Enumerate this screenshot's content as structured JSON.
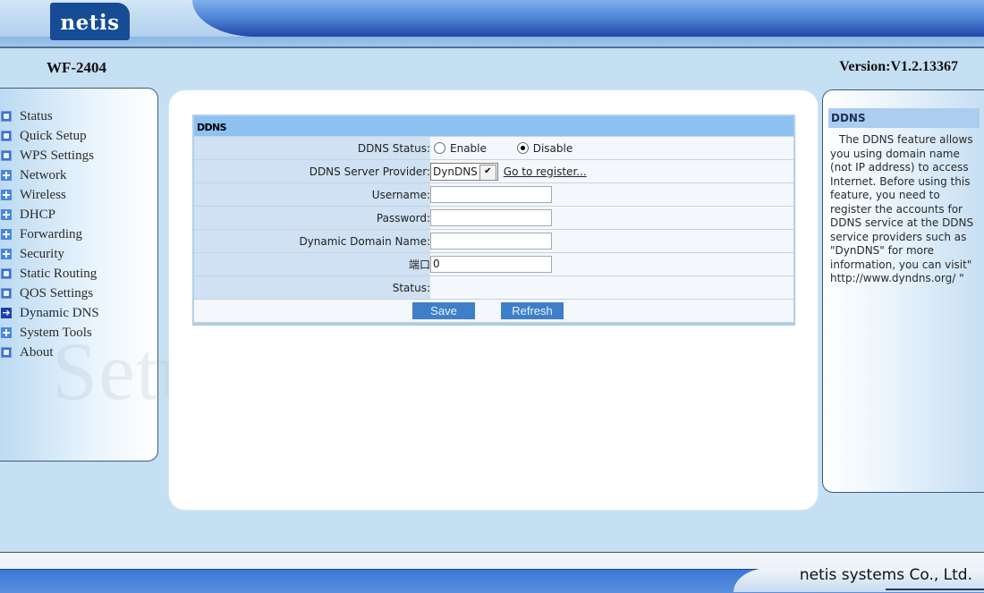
{
  "header": {
    "logo": "netis",
    "model": "WF-2404",
    "version": "Version:V1.2.13367"
  },
  "sidebar": {
    "items": [
      {
        "label": "Status",
        "icon": "box-icon"
      },
      {
        "label": "Quick Setup",
        "icon": "box-icon"
      },
      {
        "label": "WPS Settings",
        "icon": "box-icon"
      },
      {
        "label": "Network",
        "icon": "plus-icon"
      },
      {
        "label": "Wireless",
        "icon": "plus-icon"
      },
      {
        "label": "DHCP",
        "icon": "plus-icon"
      },
      {
        "label": "Forwarding",
        "icon": "plus-icon"
      },
      {
        "label": "Security",
        "icon": "plus-icon"
      },
      {
        "label": "Static Routing",
        "icon": "box-icon"
      },
      {
        "label": "QOS Settings",
        "icon": "box-icon"
      },
      {
        "label": "Dynamic DNS",
        "icon": "arrow-right-icon",
        "active": true
      },
      {
        "label": "System Tools",
        "icon": "plus-icon"
      },
      {
        "label": "About",
        "icon": "box-icon"
      }
    ]
  },
  "ddns": {
    "section_title": "DDNS",
    "status_label": "DDNS Status:",
    "enable_label": "Enable",
    "disable_label": "Disable",
    "status_selected": "Disable",
    "provider_label": "DDNS Server Provider:",
    "provider_value": "DynDNS",
    "register_link": "Go to register...",
    "username_label": "Username:",
    "username_value": "",
    "password_label": "Password:",
    "password_value": "",
    "domain_label": "Dynamic Domain Name:",
    "domain_value": "",
    "port_label": "端口",
    "port_value": "0",
    "result_status_label": "Status:",
    "result_status_value": "",
    "save_label": "Save",
    "refresh_label": "Refresh"
  },
  "help": {
    "title": "DDNS",
    "text": "The DDNS feature allows you using domain name (not IP address) to access Internet. Before using this feature, you need to register the accounts for DDNS service at the DDNS service providers such as \"DynDNS\" for more information, you can visit\" http://www.dyndns.org/ \""
  },
  "watermark": "SetupRouter.com",
  "footer": {
    "company": "netis systems Co., Ltd."
  },
  "colors": {
    "header_blue": "#2346a6",
    "logo_bg": "#164b95",
    "page_bg": "#c5dff3",
    "section_header": "#8cc1f1",
    "label_cell": "#cfe1f2",
    "button_blue": "#3f7fc9"
  }
}
